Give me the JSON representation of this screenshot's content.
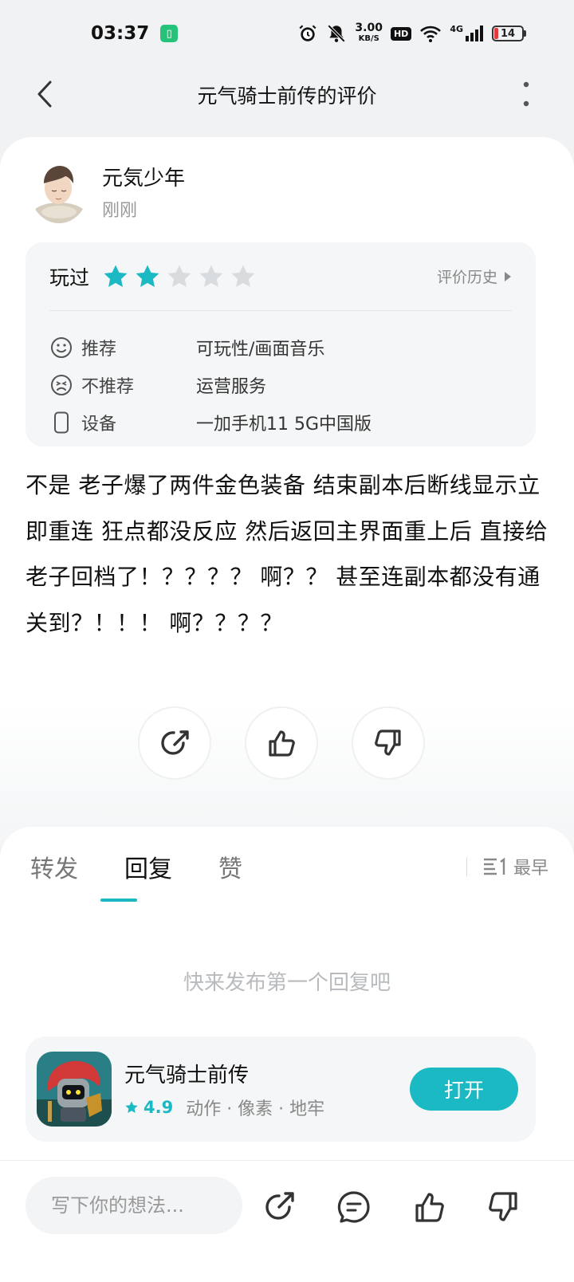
{
  "status_bar": {
    "time": "03:37",
    "net_speed_value": "3.00",
    "net_speed_unit": "KB/S",
    "hd": "HD",
    "network": "4G",
    "battery": "14"
  },
  "nav": {
    "title": "元气骑士前传的评价"
  },
  "review": {
    "user_name": "元気少年",
    "time": "刚刚",
    "played_label": "玩过",
    "rating": 2,
    "rating_max": 5,
    "history_label": "评价历史",
    "details": [
      {
        "label": "推荐",
        "value": "可玩性/画面音乐",
        "icon": "smile-icon"
      },
      {
        "label": "不推荐",
        "value": "运营服务",
        "icon": "frown-icon"
      },
      {
        "label": "设备",
        "value": "一加手机11 5G中国版",
        "icon": "phone-icon"
      }
    ],
    "text": "不是 老子爆了两件金色装备 结束副本后断线显示立即重连 狂点都没反应 然后返回主界面重上后 直接给老子回档了！？？？？ 啊？？ 甚至连副本都没有通关到？！！！ 啊？？？？"
  },
  "tabs": {
    "items": [
      "转发",
      "回复",
      "赞"
    ],
    "active": "回复",
    "sort_label": "最早",
    "empty_hint": "快来发布第一个回复吧"
  },
  "app": {
    "name": "元气骑士前传",
    "rating": "4.9",
    "tags": "动作 · 像素 · 地牢",
    "open_label": "打开"
  },
  "bottom": {
    "input_placeholder": "写下你的想法..."
  },
  "colors": {
    "accent": "#1ab9c4",
    "star_empty": "#d9dcdf"
  }
}
